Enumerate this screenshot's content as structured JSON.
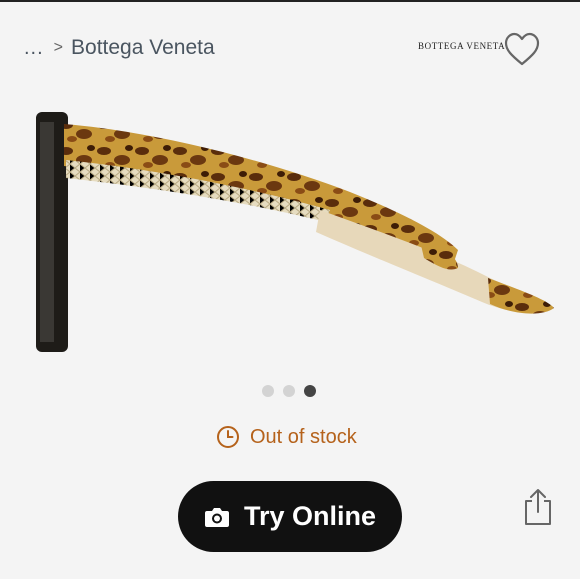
{
  "breadcrumb": {
    "ellipsis": "...",
    "separator": ">",
    "brand": "Bottega Veneta"
  },
  "brand_logo": {
    "text": "BOTTEGA VENETA"
  },
  "gallery": {
    "dot_count": 3,
    "active_index": 2
  },
  "stock": {
    "status": "Out of stock"
  },
  "actions": {
    "try_online_label": "Try Online"
  },
  "colors": {
    "accent_orange": "#b5621b",
    "button_black": "#111111",
    "dot_active": "#444444",
    "dot_inactive": "#d3d3d3"
  },
  "icons": [
    "heart-icon",
    "clock-icon",
    "camera-icon",
    "share-icon"
  ]
}
